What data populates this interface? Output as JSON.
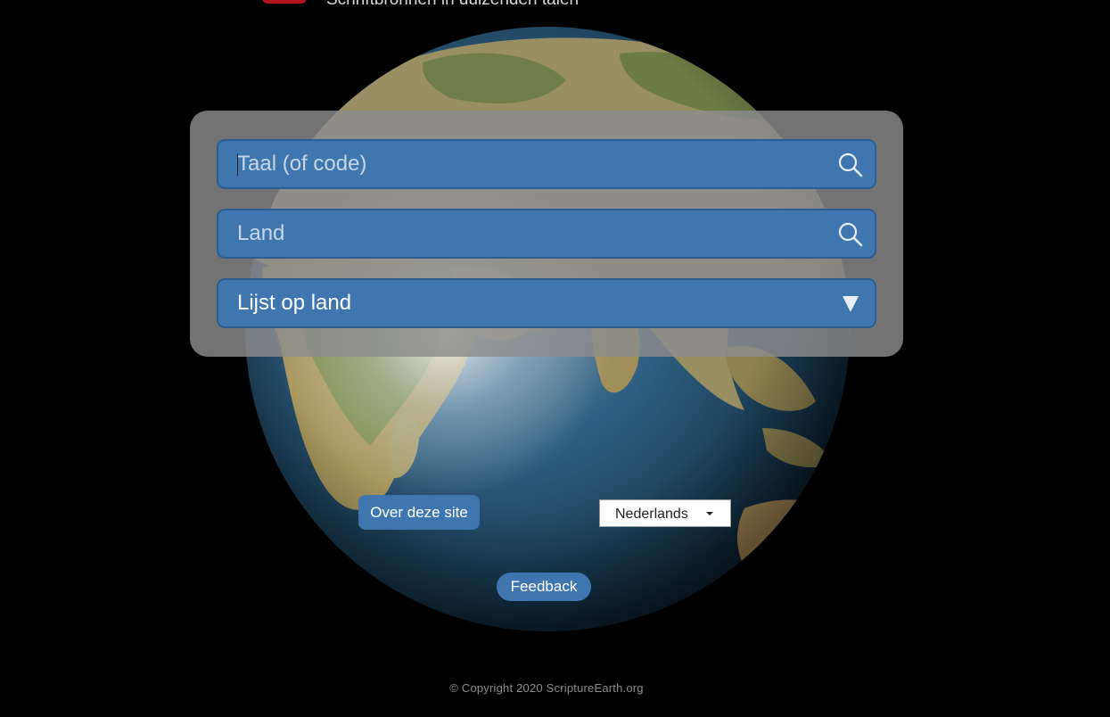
{
  "header": {
    "tagline": "Schriftbronnen in duizenden talen"
  },
  "search": {
    "language_placeholder": "Taal (of code)",
    "country_placeholder": "Land",
    "list_by_country_label": "Lijst op land"
  },
  "icons": {
    "search": "search-icon",
    "dropdown": "triangle-down-icon"
  },
  "buttons": {
    "about_label": "Over deze site",
    "feedback_label": "Feedback"
  },
  "language_select": {
    "selected": "Nederlands"
  },
  "footer": {
    "copyright": "© Copyright 2020 ScriptureEarth.org"
  },
  "colors": {
    "field_blue": "#3f76b0",
    "field_border": "#2b5d93",
    "panel_gray": "#8c8c8c",
    "logo_red": "#b3121f",
    "background": "#000000"
  }
}
